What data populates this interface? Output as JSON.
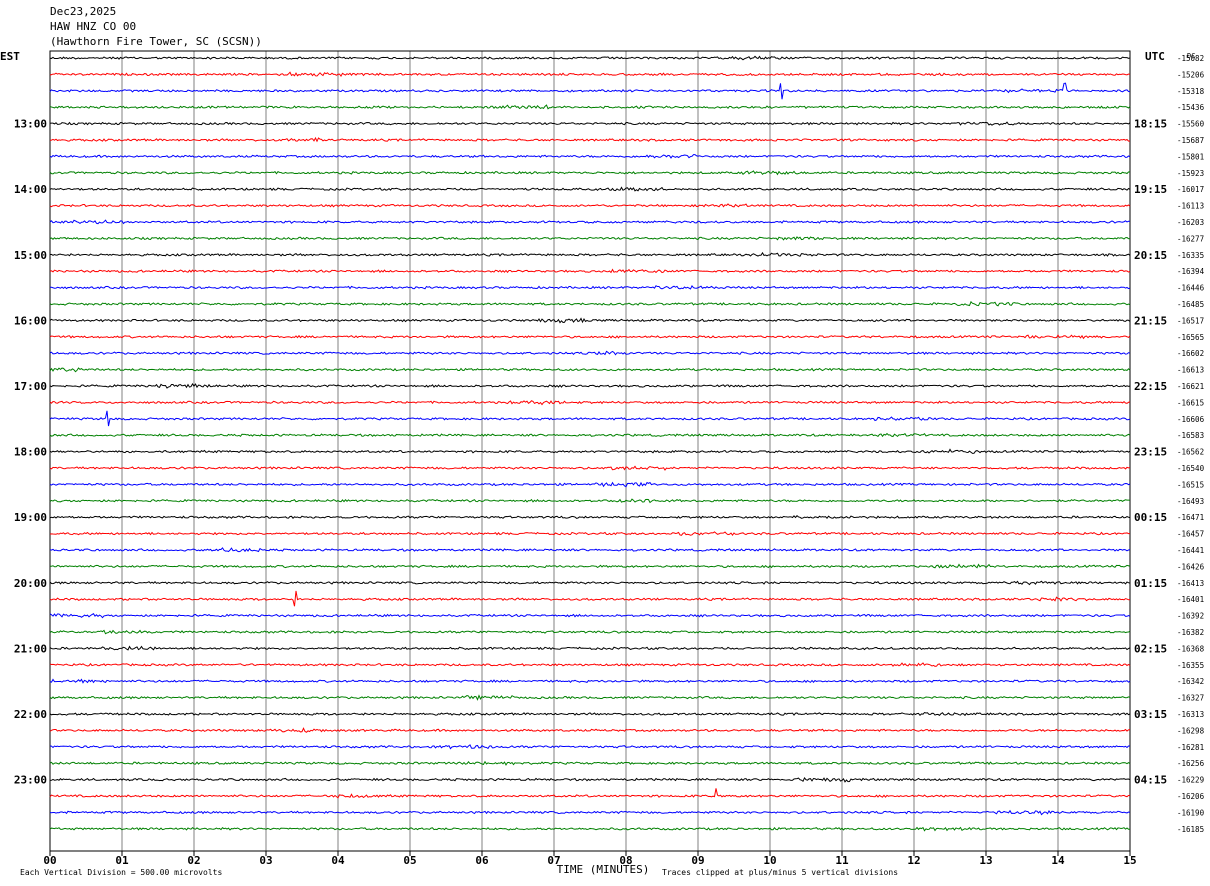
{
  "header": {
    "date": "Dec23,2025",
    "channel": "HAW HNZ CO 00",
    "station": "(Hawthorn Fire Tower, SC (SCSN))"
  },
  "left_timezone": "EST",
  "right_timezone": "UTC",
  "dc_label": "DC",
  "colors": {
    "trace_cycle": [
      "#000000",
      "#ff0000",
      "#0000ff",
      "#008000"
    ],
    "grid": "#808080",
    "axis": "#000000"
  },
  "chart_data": {
    "type": "line",
    "title": "",
    "xlabel": "TIME (MINUTES)",
    "ylabel": "",
    "xlim": [
      0,
      15
    ],
    "x_tick_labels": [
      "00",
      "01",
      "02",
      "03",
      "04",
      "05",
      "06",
      "07",
      "08",
      "09",
      "10",
      "11",
      "12",
      "13",
      "14",
      "15"
    ],
    "grid": true,
    "minutes_per_line": 15,
    "left_hour_labels": [
      "13:00",
      "14:00",
      "15:00",
      "16:00",
      "17:00",
      "18:00",
      "19:00",
      "20:00",
      "21:00",
      "22:00",
      "23:00"
    ],
    "right_hour_labels": [
      "18:15",
      "19:15",
      "20:15",
      "21:15",
      "22:15",
      "23:15",
      "00:15",
      "01:15",
      "02:15",
      "03:15",
      "04:15"
    ],
    "trace_dc_offsets": [
      -15082,
      -15206,
      -15318,
      -15436,
      -15560,
      -15687,
      -15801,
      -15923,
      -16017,
      -16113,
      -16203,
      -16277,
      -16335,
      -16394,
      -16446,
      -16485,
      -16517,
      -16565,
      -16602,
      -16613,
      -16621,
      -16615,
      -16606,
      -16583,
      -16562,
      -16540,
      -16515,
      -16493,
      -16471,
      -16457,
      -16441,
      -16426,
      -16413,
      -16401,
      -16392,
      -16382,
      -16368,
      -16355,
      -16342,
      -16327,
      -16313,
      -16298,
      -16281,
      -16256,
      -16229,
      -16206,
      -16190,
      -16185
    ],
    "notable_spikes": [
      {
        "trace": 22,
        "minute": 0.8
      },
      {
        "trace": 33,
        "minute": 3.4
      },
      {
        "trace": 2,
        "minute": 10.15
      },
      {
        "trace": 2,
        "minute": 14.1
      },
      {
        "trace": 45,
        "minute": 9.25
      }
    ]
  },
  "footer": {
    "scale_note": "Each Vertical Division =  500.00 microvolts",
    "clip_note": "Traces clipped at plus/minus 5 vertical divisions"
  }
}
